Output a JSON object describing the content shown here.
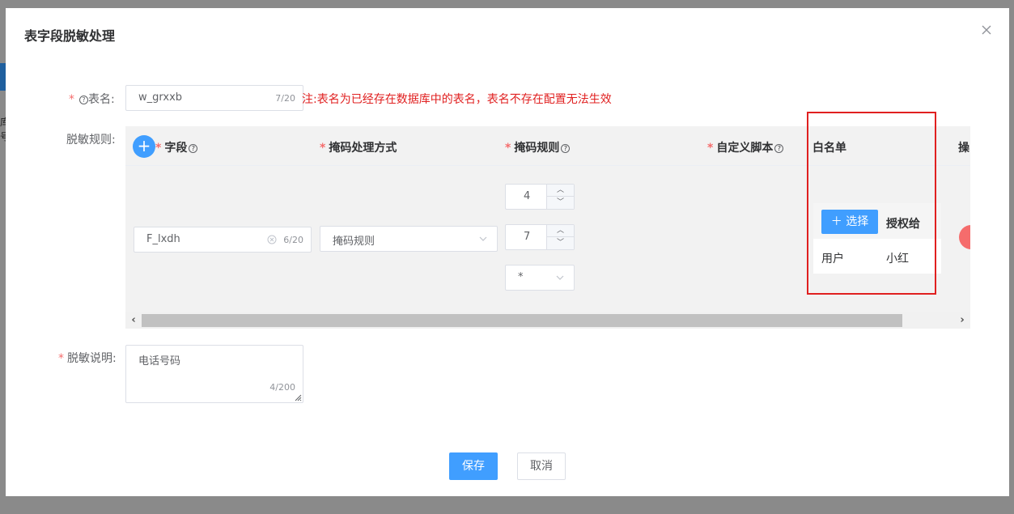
{
  "dialog": {
    "title": "表字段脱敏处理",
    "close_icon": "close-icon"
  },
  "table_name": {
    "label": "表名:",
    "value": "w_grxxb",
    "count": "7/20",
    "tip": "注:表名为已经存在数据库中的表名，表名不存在配置无法生效"
  },
  "rules": {
    "label": "脱敏规则:",
    "columns": {
      "field": "字段",
      "mask_method": "掩码处理方式",
      "mask_rule": "掩码规则",
      "custom_script": "自定义脚本",
      "whitelist": "白名单",
      "action": "操"
    },
    "row": {
      "field_value": "F_lxdh",
      "field_count": "6/20",
      "mask_method": "掩码规则",
      "rule_start": "4",
      "rule_end": "7",
      "rule_char": "*",
      "whitelist": {
        "choose_label": "选择",
        "grant_label": "授权给",
        "type": "用户",
        "name": "小红"
      }
    }
  },
  "description": {
    "label": "脱敏说明:",
    "value": "电话号码",
    "count": "4/200"
  },
  "footer": {
    "save": "保存",
    "cancel": "取消"
  },
  "colors": {
    "primary": "#409eff",
    "danger": "#f56c6c",
    "highlight": "#e02020"
  },
  "background": {
    "text_1": "库",
    "text_2": "号"
  }
}
